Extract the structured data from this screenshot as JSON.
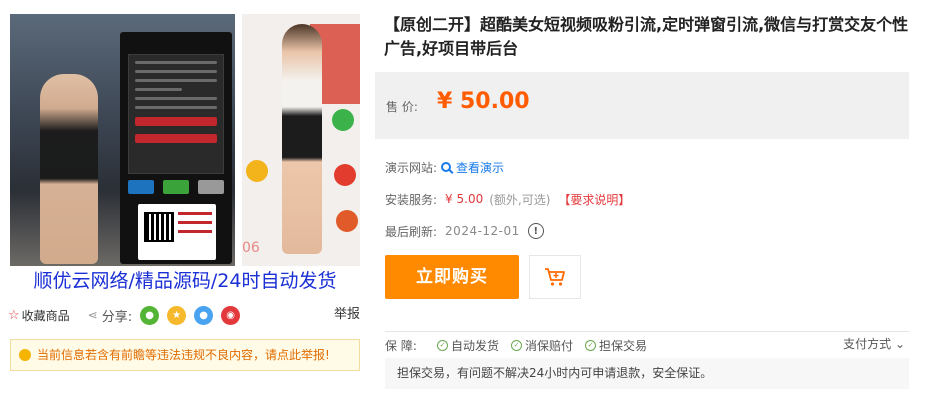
{
  "gallery": {
    "caption": "顺优云网络/精品源码/24时自动发货",
    "watermark": "06"
  },
  "share_bar": {
    "favorite_label": "收藏商品",
    "share_label": "分享:",
    "report_label": "举报",
    "networks": [
      {
        "icon": "wechat-icon",
        "color": "#54b435"
      },
      {
        "icon": "qzone-icon",
        "color": "#f6b92b"
      },
      {
        "icon": "qq-icon",
        "color": "#4aa3f0"
      },
      {
        "icon": "weibo-icon",
        "color": "#e4393c"
      }
    ]
  },
  "notice": {
    "text": "当前信息若含有前瞻等违法违规不良内容，请点此举报!"
  },
  "product": {
    "title": "【原创二开】超酷美女短视频吸粉引流,定时弹窗引流,微信与打赏交友个性广告,好项目带后台",
    "price_label": "售 价:",
    "price": "¥ 50.00",
    "accent_color": "#ff5b00"
  },
  "info": {
    "demo_key": "演示网站:",
    "demo_link": "查看演示",
    "service_key": "安装服务:",
    "service_price": "¥ 5.00",
    "service_note": "(额外,可选)",
    "service_requirement": "【要求说明】",
    "refresh_key": "最后刷新:",
    "refresh_date": "2024-12-01"
  },
  "actions": {
    "buy_label": "立即购买",
    "buy_color": "#ff8a00"
  },
  "guarantee": {
    "label": "保 障:",
    "items": [
      "自动发货",
      "消保赔付",
      "担保交易"
    ],
    "payment_label": "支付方式",
    "description": "担保交易，有问题不解决24小时内可申请退款，安全保证。"
  }
}
